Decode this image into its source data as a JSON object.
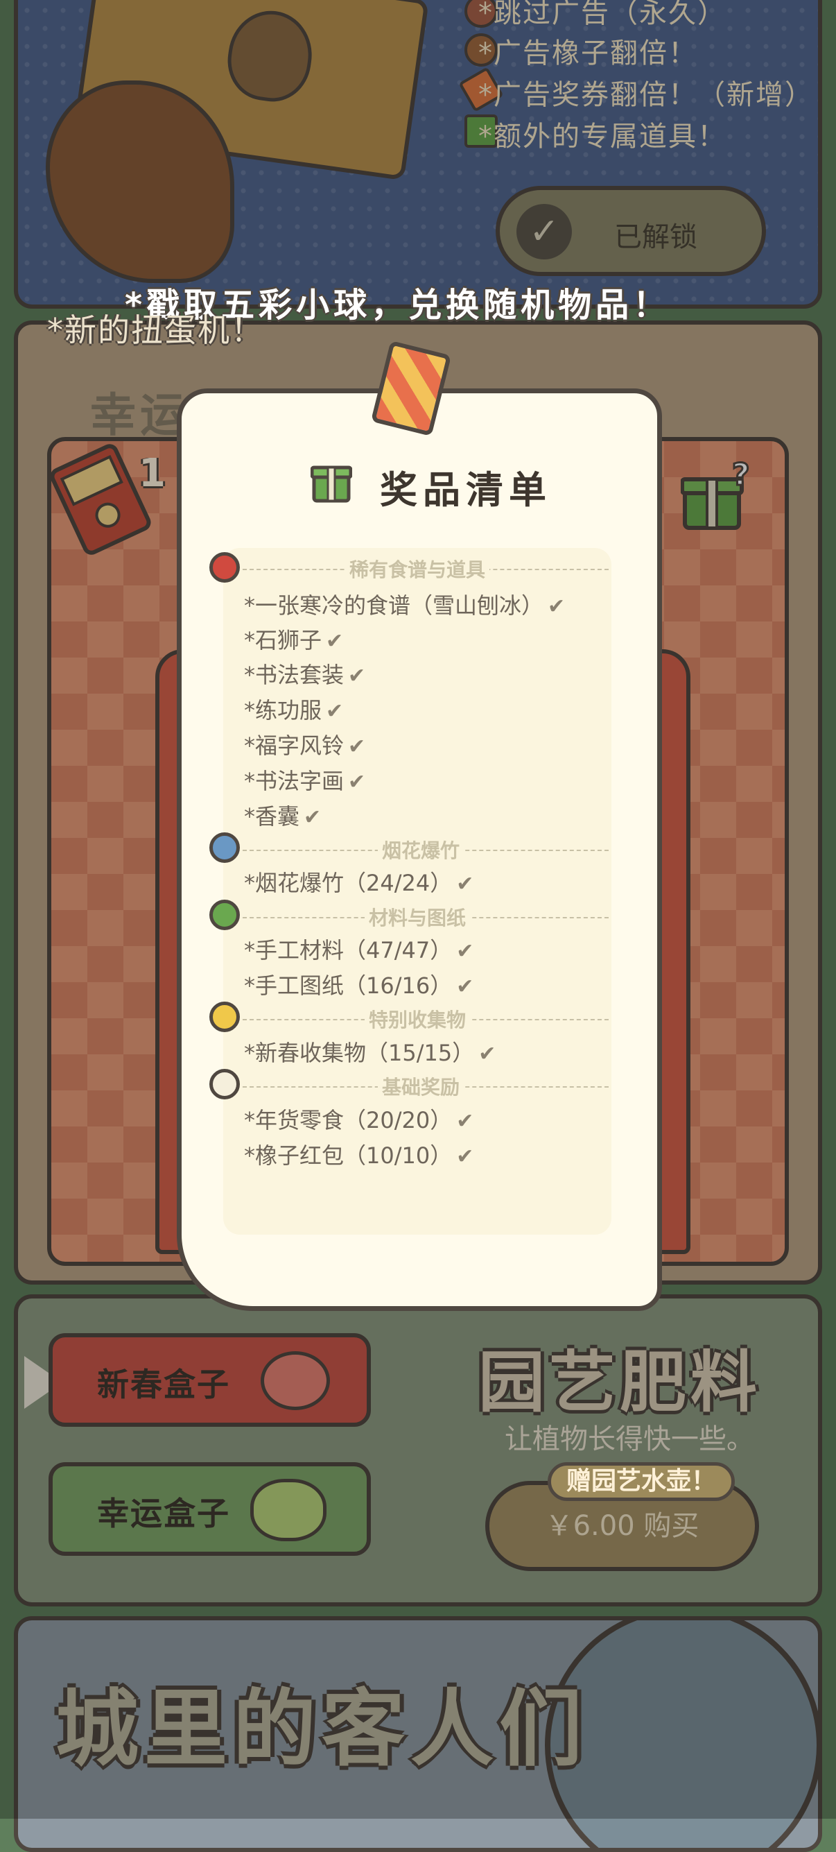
{
  "top_panel": {
    "perks": [
      "*跳过广告（永久）",
      "*广告橡子翻倍！",
      "*广告奖券翻倍！（新增）",
      "*额外的专属道具！"
    ],
    "unlocked_label": "已解锁"
  },
  "gacha": {
    "tip": "*戳取五彩小球，兑换随机物品！",
    "new_machine": "*新的扭蛋机！",
    "title": "幸运扭蛋机",
    "ticket_count": "1"
  },
  "prize_list": {
    "title": "奖品清单",
    "sections": [
      {
        "heading": "稀有食谱与道具",
        "ball_color": "#d04a3f",
        "items": [
          "*一张寒冷的食谱（雪山刨冰）",
          "*石狮子",
          "*书法套装",
          "*练功服",
          "*福字风铃",
          "*书法字画",
          "*香囊"
        ]
      },
      {
        "heading": "烟花爆竹",
        "ball_color": "#6a98c4",
        "items": [
          "*烟花爆竹（24/24）"
        ]
      },
      {
        "heading": "材料与图纸",
        "ball_color": "#6aa84f",
        "items": [
          "*手工材料（47/47）",
          "*手工图纸（16/16）"
        ]
      },
      {
        "heading": "特别收集物",
        "ball_color": "#f0c84a",
        "items": [
          "*新春收集物（15/15）"
        ]
      },
      {
        "heading": "基础奖励",
        "ball_color": "#f5efdc",
        "items": [
          "*年货零食（20/20）",
          "*橡子红包（10/10）"
        ]
      }
    ]
  },
  "boxes": {
    "spring_box": "新春盒子",
    "lucky_box": "幸运盒子"
  },
  "garden": {
    "title": "园艺肥料",
    "subtitle": "让植物长得快一些。",
    "gift_tag": "赠园艺水壶！",
    "price_label": "￥6.00 购买"
  },
  "city": {
    "title": "城里的客人们"
  },
  "colors": {
    "dialog_bg": "#fffbec",
    "outline": "#4f4740",
    "accent_red": "#c8574a",
    "accent_green": "#7fa56a"
  }
}
